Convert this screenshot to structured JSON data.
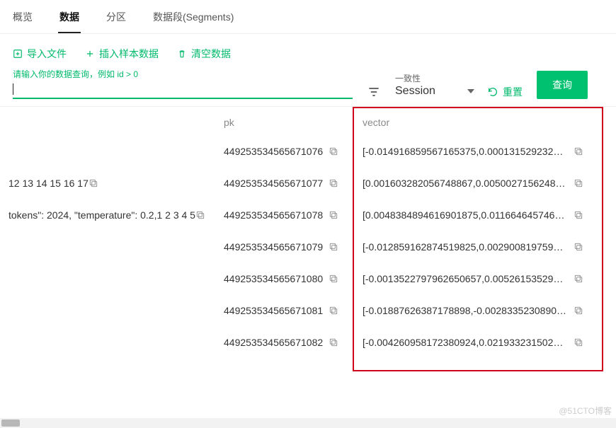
{
  "tabs": {
    "overview": "概览",
    "data": "数据",
    "partition": "分区",
    "segments": "数据段(Segments)"
  },
  "toolbar": {
    "import": "导入文件",
    "insert": "插入样本数据",
    "clear": "清空数据"
  },
  "query": {
    "label": "请输入你的数据查询，例如 id > 0",
    "value": ""
  },
  "consistency": {
    "label": "一致性",
    "value": "Session"
  },
  "actions": {
    "reset": "重置",
    "query": "查询"
  },
  "columns": {
    "pk": "pk",
    "vector": "vector"
  },
  "rows": [
    {
      "col1": "",
      "copy1": false,
      "pk": "449253534565671076",
      "vector": "[-0.014916859567165375,0.000131529232021..."
    },
    {
      "col1": "12 13 14 15 16 17",
      "copy1": true,
      "pk": "449253534565671077",
      "vector": "[0.001603282056748867,0.0050027156248688..."
    },
    {
      "col1": "tokens\": 2024, \"temperature\": 0.2,1 2 3 4 5",
      "copy1": true,
      "pk": "449253534565671078",
      "vector": "[0.0048384894616901875,0.011664645746350..."
    },
    {
      "col1": "",
      "copy1": false,
      "pk": "449253534565671079",
      "vector": "[-0.012859162874519825,0.002900819759815..."
    },
    {
      "col1": "",
      "copy1": false,
      "pk": "449253534565671080",
      "vector": "[-0.0013522797962650657,0.00526153529062..."
    },
    {
      "col1": "",
      "copy1": false,
      "pk": "449253534565671081",
      "vector": "[-0.01887626387178898,-0.0028335230890661..."
    },
    {
      "col1": "",
      "copy1": false,
      "pk": "449253534565671082",
      "vector": "[-0.004260958172380924,0.021933231502771..."
    }
  ],
  "watermark": "@51CTO博客"
}
